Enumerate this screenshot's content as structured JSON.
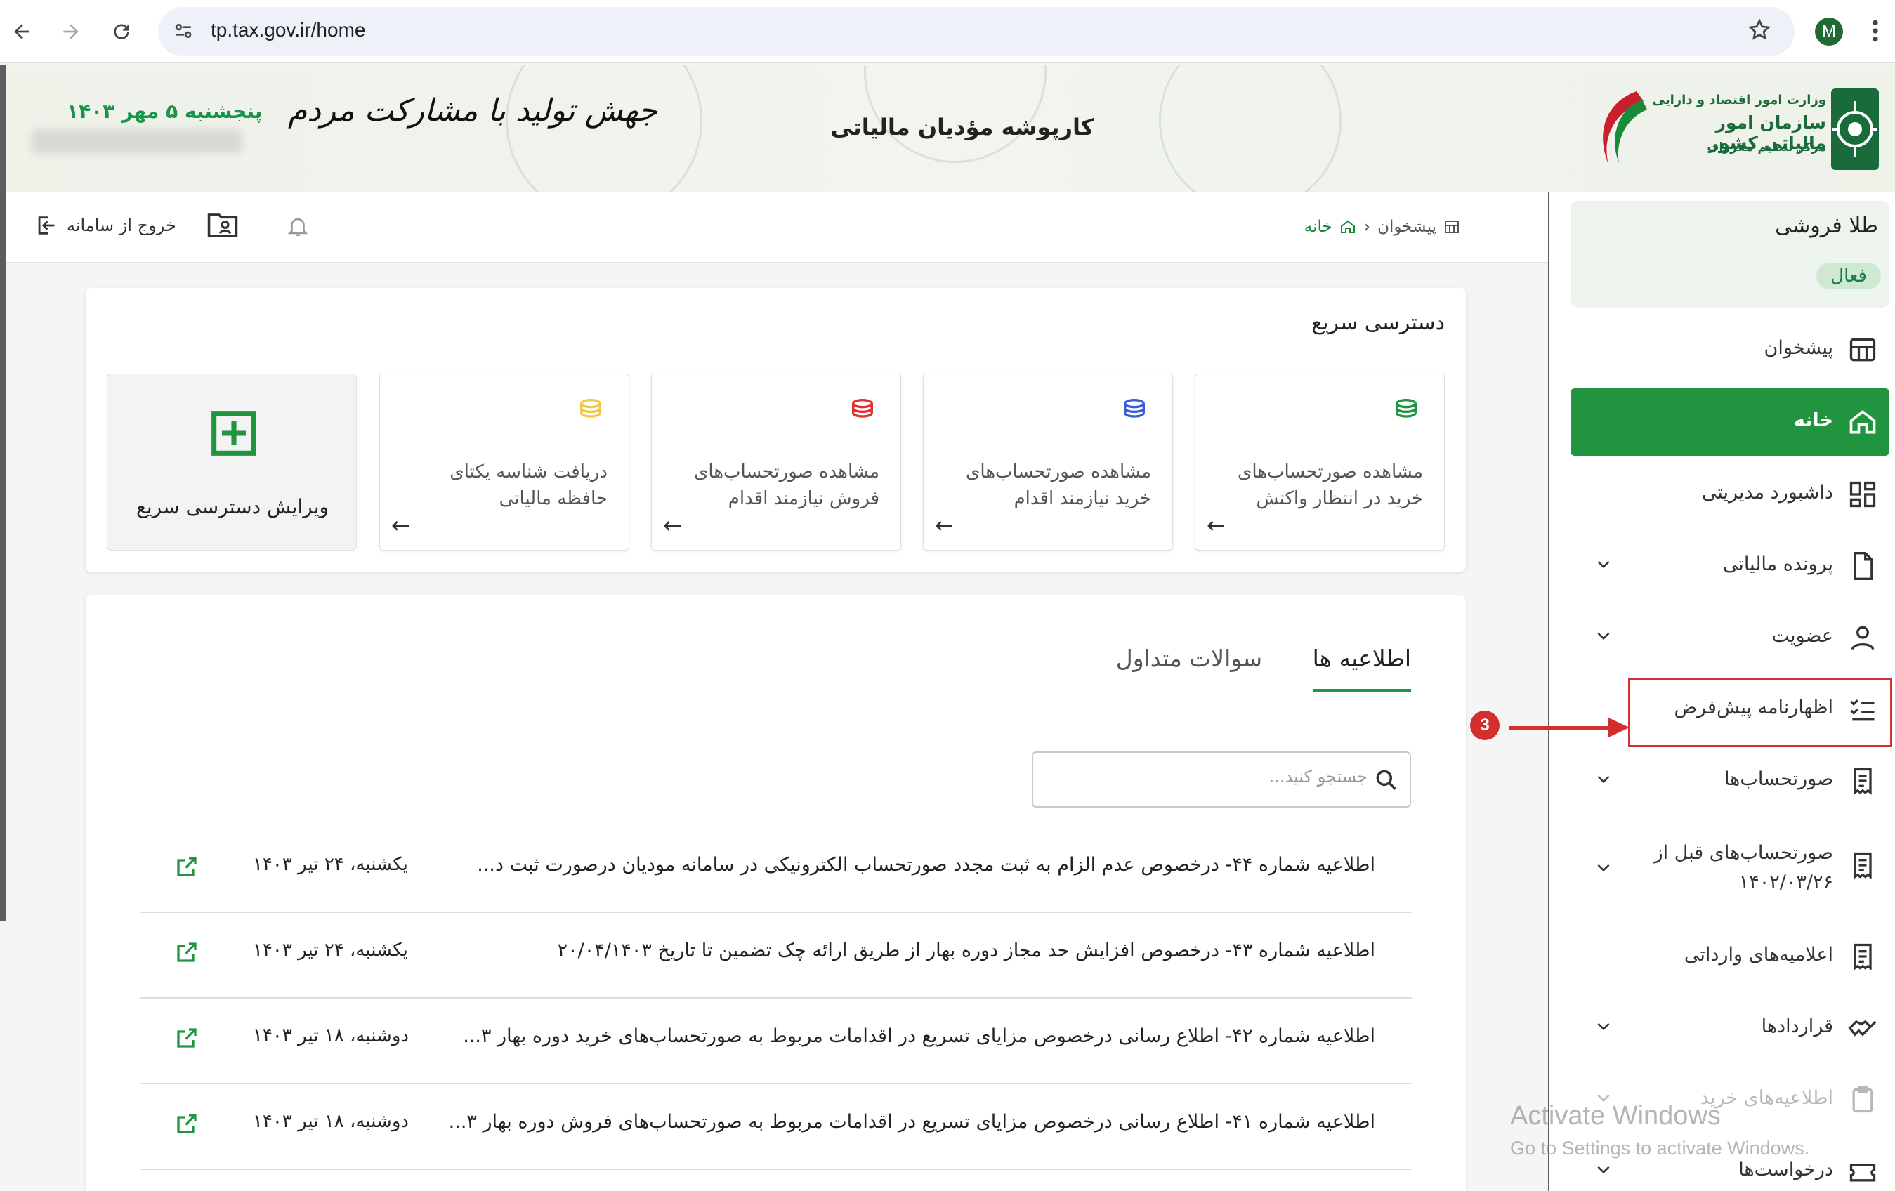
{
  "browser": {
    "url": "tp.tax.gov.ir/home",
    "avatar_letter": "M"
  },
  "header": {
    "date": "پنجشنبه ۵ مهر ۱۴۰۳",
    "slogan": "جهش تولید با مشارکت مردم",
    "portal_title": "کارپوشه مؤدیان مالیاتی",
    "logo_line1": "وزارت امور اقتصاد و دارایی",
    "logo_line2": "سازمان امور مالیاتی کشور",
    "logo_line3": "مرکز تنظیم مقررات"
  },
  "topbar": {
    "logout_label": "خروج از سامانه",
    "breadcrumb_desk": "پیشخوان",
    "breadcrumb_home": "خانه"
  },
  "sidebar": {
    "company_name": "طلا فروشی",
    "company_status": "فعال",
    "items": [
      {
        "label": "پیشخوان"
      },
      {
        "label": "خانه"
      },
      {
        "label": "داشبورد مدیریتی"
      },
      {
        "label": "پرونده مالیاتی"
      },
      {
        "label": "عضویت"
      },
      {
        "label": "اظهارنامه پیش‌فرض"
      },
      {
        "label": "صورتحساب‌ها"
      },
      {
        "label": "صورتحساب‌های قبل از ۱۴۰۲/۰۳/۲۶"
      },
      {
        "label": "اعلامیه‌های وارداتی"
      },
      {
        "label": "قراردادها"
      },
      {
        "label": "اطلاعیه‌های خرید"
      },
      {
        "label": "درخواست‌ها"
      }
    ]
  },
  "annotation": {
    "step_number": "3"
  },
  "quick_access": {
    "title": "دسترسی سریع",
    "tiles": [
      {
        "label": "مشاهده صورتحساب‌های خرید در انتظار واکنش",
        "color": "#21943f"
      },
      {
        "label": "مشاهده صورتحساب‌های خرید نیازمند اقدام",
        "color": "#3b5bdb"
      },
      {
        "label": "مشاهده صورتحساب‌های فروش نیازمند اقدام",
        "color": "#e03131"
      },
      {
        "label": "دریافت شناسه یکتای حافظه مالیاتی",
        "color": "#f2c744"
      }
    ],
    "edit_label": "ویرایش دسترسی سریع"
  },
  "notices": {
    "tab_notices": "اطلاعیه ها",
    "tab_faq": "سوالات متداول",
    "search_placeholder": "جستجو کنید...",
    "rows": [
      {
        "title": "اطلاعیه شماره ۴۴- درخصوص عدم الزام به ثبت مجدد صورتحساب الکترونیکی در سامانه مودیان درصورت ثبت د...",
        "date": "یکشنبه، ۲۴ تیر ۱۴۰۳"
      },
      {
        "title": "اطلاعیه شماره ۴۳- درخصوص افزایش حد مجاز دوره بهار از طریق ارائه چک تضمین تا تاریخ ۲۰/۰۴/۱۴۰۳",
        "date": "یکشنبه، ۲۴ تیر ۱۴۰۳"
      },
      {
        "title": "اطلاعیه شماره ۴۲- اطلاع رسانی درخصوص مزایای تسریع در اقدامات مربوط به صورتحساب‌های خرید دوره بهار ۳...",
        "date": "دوشنبه، ۱۸ تیر ۱۴۰۳"
      },
      {
        "title": "اطلاعیه شماره ۴۱- اطلاع رسانی درخصوص مزایای تسریع در اقدامات مربوط به صورتحساب‌های فروش دوره بهار ۳...",
        "date": "دوشنبه، ۱۸ تیر ۱۴۰۳"
      }
    ]
  },
  "watermark": {
    "line1": "Activate Windows",
    "line2": "Go to Settings to activate Windows."
  },
  "colors": {
    "brand_green": "#21943f",
    "annotation_red": "#d32f2f"
  }
}
